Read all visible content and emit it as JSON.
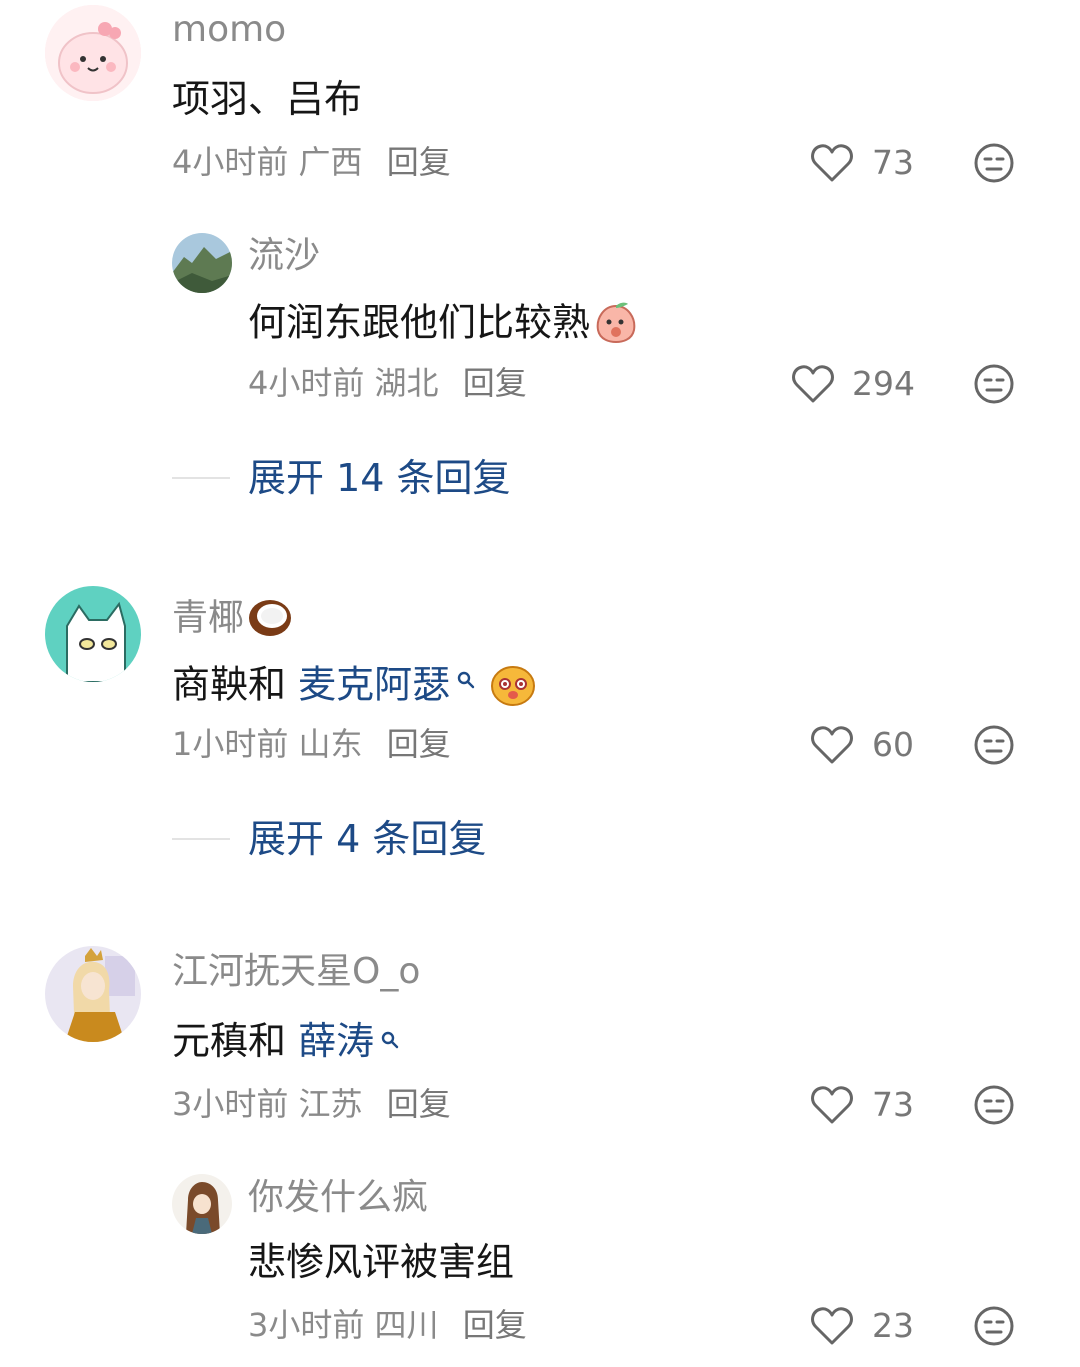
{
  "comments": [
    {
      "username": "momo",
      "text": "项羽、吕布",
      "time": "4小时前",
      "location": "广西",
      "reply_label": "回复",
      "likes": "73",
      "replies": [
        {
          "username": "流沙",
          "text": "何润东跟他们比较熟",
          "time": "4小时前",
          "location": "湖北",
          "reply_label": "回复",
          "likes": "294"
        }
      ],
      "expand_label": "展开 14 条回复"
    },
    {
      "username": "青椰",
      "text_plain": "商鞅和 ",
      "text_link": "麦克阿瑟",
      "time": "1小时前",
      "location": "山东",
      "reply_label": "回复",
      "likes": "60",
      "expand_label": "展开 4 条回复"
    },
    {
      "username": "江河抚天星O_o",
      "text_plain": "元稹和 ",
      "text_link": "薛涛",
      "time": "3小时前",
      "location": "江苏",
      "reply_label": "回复",
      "likes": "73",
      "replies": [
        {
          "username": "你发什么疯",
          "text": "悲惨风评被害组",
          "time": "3小时前",
          "location": "四川",
          "reply_label": "回复",
          "likes": "23"
        }
      ]
    }
  ],
  "icons": {
    "like": "heart-outline-icon",
    "dislike": "neutral-face-icon",
    "search": "search-icon"
  },
  "colors": {
    "link": "#1d4a86",
    "meta": "#8a8a8a",
    "text": "#161616"
  }
}
